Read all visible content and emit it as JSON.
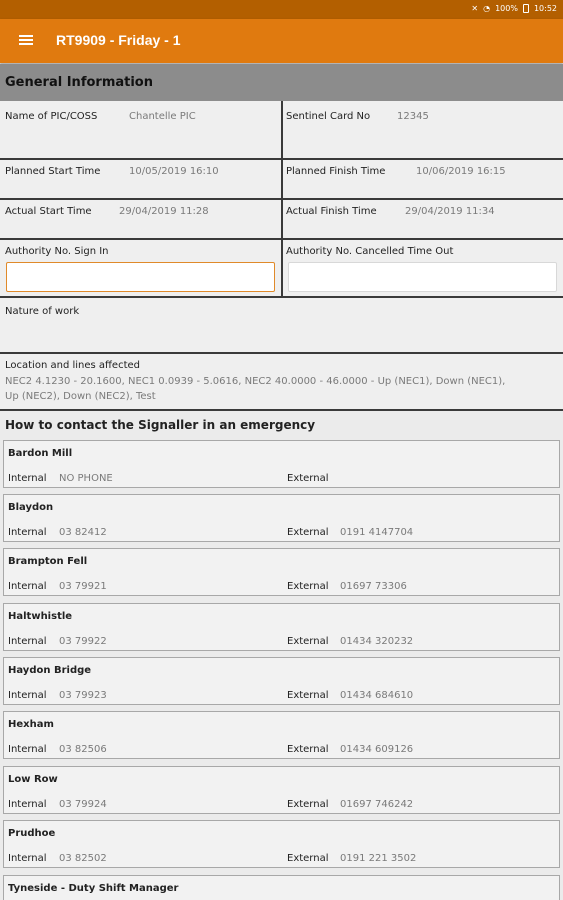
{
  "status_bar": {
    "icons": [
      "mute-icon",
      "wifi-icon",
      "battery-icon"
    ],
    "battery": "100%",
    "time": "10:52"
  },
  "app_bar": {
    "menu_icon": "menu-icon",
    "title": "RT9909 - Friday - 1"
  },
  "general": {
    "title": "General Information",
    "pic_label": "Name of PIC/COSS",
    "pic_value": "Chantelle PIC",
    "sentinel_label": "Sentinel Card No",
    "sentinel_value": "12345",
    "planned_start_label": "Planned Start Time",
    "planned_start_value": "10/05/2019 16:10",
    "planned_finish_label": "Planned Finish Time",
    "planned_finish_value": "10/06/2019 16:15",
    "actual_start_label": "Actual Start Time",
    "actual_start_value": "29/04/2019 11:28",
    "actual_finish_label": "Actual Finish Time",
    "actual_finish_value": "29/04/2019 11:34",
    "auth_sign_in_label": "Authority No. Sign In",
    "auth_sign_in_value": "",
    "auth_cancel_label": "Authority No. Cancelled Time Out",
    "auth_cancel_value": "",
    "nature_label": "Nature of work",
    "nature_value": "",
    "location_label": "Location and lines affected",
    "location_value_1": "NEC2 4.1230 - 20.1600, NEC1 0.0939 - 5.0616, NEC2 40.0000 - 46.0000 - Up (NEC1), Down (NEC1),",
    "location_value_2": "Up (NEC2), Down (NEC2), Test"
  },
  "emergency": {
    "title": "How to contact the Signaller in an emergency",
    "internal_label": "Internal",
    "external_label": "External",
    "signallers": [
      {
        "name": "Bardon Mill",
        "internal": "NO PHONE",
        "external": ""
      },
      {
        "name": "Blaydon",
        "internal": "03 82412",
        "external": "0191 4147704"
      },
      {
        "name": "Brampton Fell",
        "internal": "03 79921",
        "external": "01697 73306"
      },
      {
        "name": "Haltwhistle",
        "internal": "03 79922",
        "external": "01434 320232"
      },
      {
        "name": "Haydon Bridge",
        "internal": "03 79923",
        "external": "01434 684610"
      },
      {
        "name": "Hexham",
        "internal": "03 82506",
        "external": "01434 609126"
      },
      {
        "name": "Low Row",
        "internal": "03 79924",
        "external": "01697 746242"
      },
      {
        "name": "Prudhoe",
        "internal": "03 82502",
        "external": "0191 221 3502"
      },
      {
        "name": "Tyneside - Duty Shift Manager",
        "internal": "",
        "external": ""
      }
    ]
  }
}
